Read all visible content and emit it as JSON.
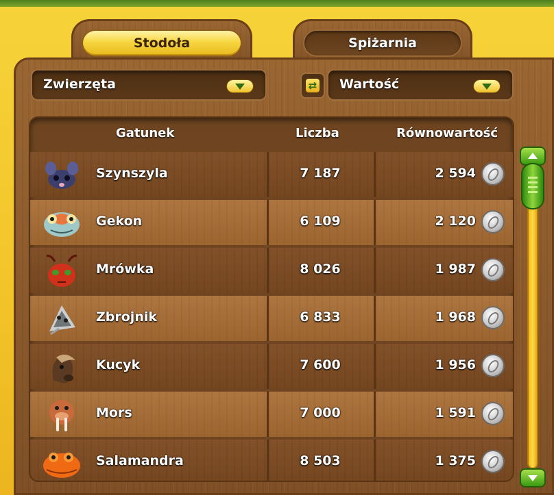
{
  "tabs": [
    {
      "label": "Stodoła",
      "active": true
    },
    {
      "label": "Spiżarnia",
      "active": false
    }
  ],
  "filters": {
    "category": "Zwierzęta",
    "sort_by": "Wartość"
  },
  "table": {
    "headers": {
      "species": "Gatunek",
      "count": "Liczba",
      "value": "Równowartość"
    },
    "rows": [
      {
        "name": "Szynszyla",
        "count": "7 187",
        "value": "2 594",
        "icon": "chinchilla-icon"
      },
      {
        "name": "Gekon",
        "count": "6 109",
        "value": "2 120",
        "icon": "gecko-icon"
      },
      {
        "name": "Mrówka",
        "count": "8 026",
        "value": "1 987",
        "icon": "ant-icon"
      },
      {
        "name": "Zbrojnik",
        "count": "6 833",
        "value": "1 968",
        "icon": "armored-catfish-icon"
      },
      {
        "name": "Kucyk",
        "count": "7 600",
        "value": "1 956",
        "icon": "pony-icon"
      },
      {
        "name": "Mors",
        "count": "7 000",
        "value": "1 591",
        "icon": "walrus-icon"
      },
      {
        "name": "Salamandra",
        "count": "8 503",
        "value": "1 375",
        "icon": "salamander-icon"
      }
    ]
  },
  "colors": {
    "background": "#f3c52a",
    "wood": "#8a5a2b",
    "coin": "#cfcfcf",
    "scrollbar": "#3a9a12"
  }
}
